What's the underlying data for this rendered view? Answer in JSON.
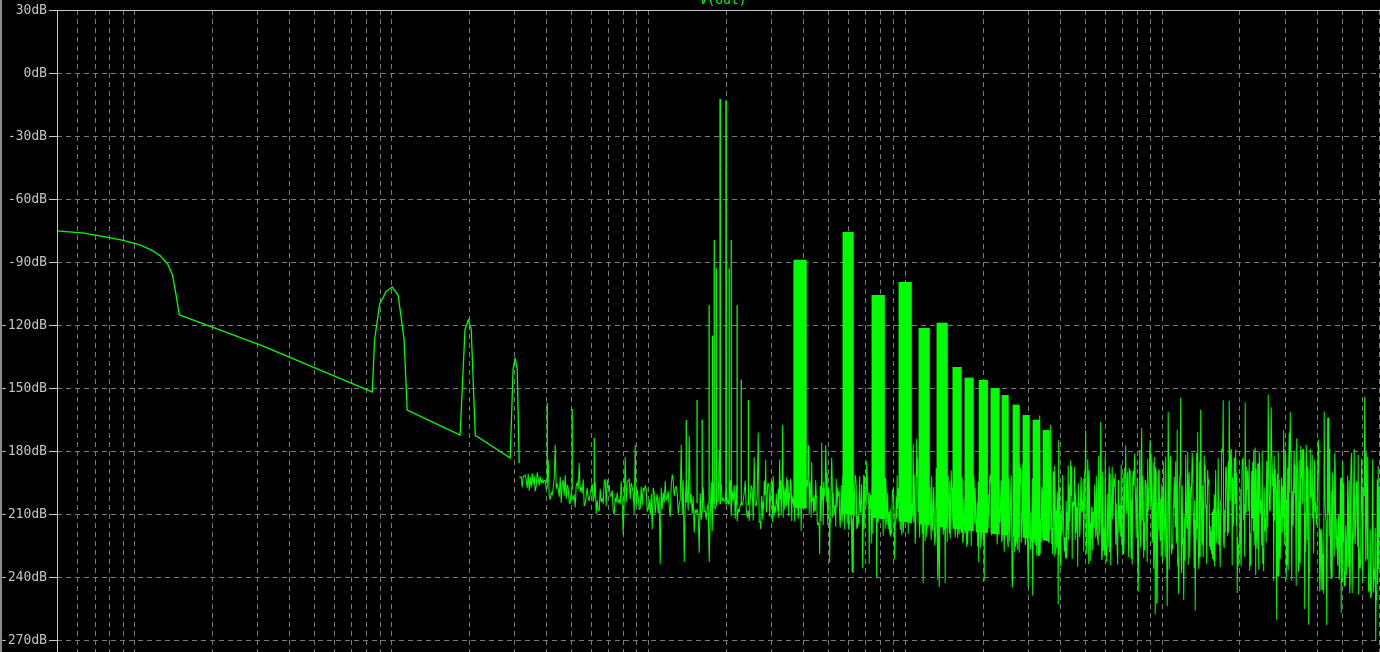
{
  "chart_data": {
    "type": "line",
    "title": "V(out)",
    "xlabel": "",
    "ylabel": "",
    "xscale": "log",
    "x_units": "decades relative to first full decade gridline (no frequency labels visible)",
    "xlim": [
      -0.301,
      4.848
    ],
    "ylim": [
      -275.7,
      30
    ],
    "grid": true,
    "y_ticks": [
      {
        "value": 30,
        "label": "30dB"
      },
      {
        "value": 0,
        "label": "0dB"
      },
      {
        "value": -30,
        "label": "-30dB"
      },
      {
        "value": -60,
        "label": "-60dB"
      },
      {
        "value": -90,
        "label": "-90dB"
      },
      {
        "value": -120,
        "label": "-120dB"
      },
      {
        "value": -150,
        "label": "-150dB"
      },
      {
        "value": -180,
        "label": "-180dB"
      },
      {
        "value": -210,
        "label": "-210dB"
      },
      {
        "value": -240,
        "label": "-240dB"
      },
      {
        "value": -270,
        "label": "-270dB"
      }
    ],
    "series": [
      {
        "name": "V(out)",
        "color": "#00ff00",
        "low_freq_trace": [
          [
            -0.301,
            -75.2
          ],
          [
            -0.2,
            -76.2
          ],
          [
            -0.132,
            -77.6
          ],
          [
            -0.05,
            -79.5
          ],
          [
            0.023,
            -81.9
          ],
          [
            0.07,
            -84.5
          ],
          [
            0.101,
            -87.1
          ],
          [
            0.13,
            -91
          ],
          [
            0.148,
            -96.2
          ],
          [
            0.16,
            -104
          ],
          [
            0.175,
            -115.2
          ],
          [
            0.5,
            -130
          ],
          [
            0.926,
            -151.9
          ],
          [
            0.935,
            -127
          ],
          [
            0.955,
            -110
          ],
          [
            0.98,
            -104
          ],
          [
            1.004,
            -101.9
          ],
          [
            1.027,
            -106
          ],
          [
            1.05,
            -127
          ],
          [
            1.062,
            -160.5
          ],
          [
            1.268,
            -172.4
          ],
          [
            1.287,
            -122
          ],
          [
            1.3,
            -117.6
          ],
          [
            1.311,
            -122
          ],
          [
            1.327,
            -172.7
          ],
          [
            1.34,
            -173.5
          ],
          [
            1.463,
            -183.3
          ],
          [
            1.474,
            -141
          ],
          [
            1.482,
            -135.7
          ],
          [
            1.49,
            -141
          ],
          [
            1.498,
            -185.7
          ]
        ],
        "main_peaks": [
          {
            "x": 2.28,
            "db": -12.4
          },
          {
            "x": 2.303,
            "db": -13.3
          }
        ],
        "sidebands": [
          {
            "x": 2.148,
            "db": -165.2
          },
          {
            "x": 2.19,
            "db": -155.7
          },
          {
            "x": 2.21,
            "db": -165
          },
          {
            "x": 2.237,
            "db": -110.5
          },
          {
            "x": 2.25,
            "db": -125
          },
          {
            "x": 2.257,
            "db": -79.5
          },
          {
            "x": 2.265,
            "db": -93
          },
          {
            "x": 2.315,
            "db": -93
          },
          {
            "x": 2.323,
            "db": -79.5
          },
          {
            "x": 2.346,
            "db": -110.5
          },
          {
            "x": 2.362,
            "db": -146
          },
          {
            "x": 2.39,
            "db": -155.7
          }
        ],
        "small_spurs": [
          {
            "x": 1.607,
            "db": -157.1
          },
          {
            "x": 1.704,
            "db": -160
          },
          {
            "x": 1.79,
            "db": -173.8
          }
        ],
        "harmonic_clusters": [
          {
            "x": 2.591,
            "db": -89,
            "width": 0.047
          },
          {
            "x": 2.778,
            "db": -75.7,
            "width": 0.039
          },
          {
            "x": 2.895,
            "db": -105.7,
            "width": 0.047
          },
          {
            "x": 3.0,
            "db": -99.5,
            "width": 0.047
          },
          {
            "x": 3.074,
            "db": -121.4,
            "width": 0.039
          },
          {
            "x": 3.144,
            "db": -119,
            "width": 0.039
          },
          {
            "x": 3.202,
            "db": -140,
            "width": 0.031
          },
          {
            "x": 3.249,
            "db": -145.2,
            "width": 0.031
          },
          {
            "x": 3.304,
            "db": -146.2,
            "width": 0.031
          },
          {
            "x": 3.35,
            "db": -150,
            "width": 0.031
          },
          {
            "x": 3.389,
            "db": -153.3,
            "width": 0.023
          },
          {
            "x": 3.432,
            "db": -158,
            "width": 0.023
          },
          {
            "x": 3.471,
            "db": -162.9,
            "width": 0.023
          },
          {
            "x": 3.51,
            "db": -165.2,
            "width": 0.023
          },
          {
            "x": 3.549,
            "db": -170,
            "width": 0.023
          }
        ],
        "noise_floor": [
          [
            1.498,
            -189,
            -198.6
          ],
          [
            1.81,
            -193,
            -210.5
          ],
          [
            2.2,
            -194,
            -212.9
          ],
          [
            2.59,
            -191,
            -215
          ],
          [
            3.18,
            -189,
            -224.8
          ],
          [
            3.76,
            -182,
            -234
          ],
          [
            4.34,
            -177,
            -241
          ],
          [
            4.848,
            -177,
            -251
          ]
        ]
      }
    ]
  }
}
